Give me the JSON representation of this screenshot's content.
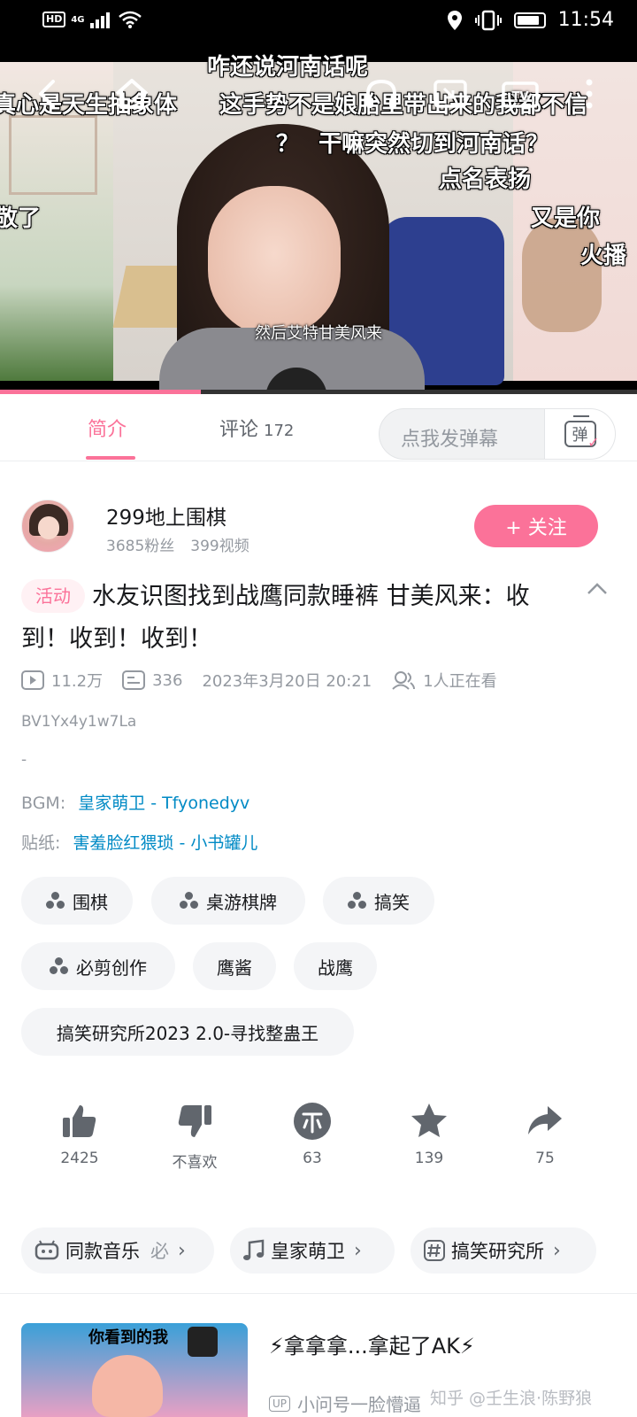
{
  "status_bar": {
    "left_badge": "HD",
    "signal": "4G",
    "time": "11:54"
  },
  "video": {
    "danmaku": [
      "咋还说河南话呢",
      "真心是天生抽象体",
      "这手势不是娘胎里带出来的我都不信",
      "？",
      "干嘛突然切到河南话？",
      "点名表扬",
      "又是你",
      "敬了",
      "火播"
    ],
    "subtitle": "然后艾特甘美风来",
    "progress_fraction": 0.315
  },
  "tabs": {
    "intro": "简介",
    "comments": "评论",
    "comments_count": "172",
    "danmaku_placeholder": "点我发弹幕",
    "danmaku_button": "弹"
  },
  "uploader": {
    "name": "299地上围棋",
    "fans": "3685粉丝",
    "videos": "399视频",
    "follow_label": "+ 关注"
  },
  "video_info": {
    "activity_tag": "活动",
    "title": "水友识图找到战鹰同款睡裤 甘美风来：收到！收到！收到！",
    "views": "11.2万",
    "danmaku_count": "336",
    "date": "2023年3月20日 20:21",
    "watching": "1人正在看",
    "bvid": "BV1Yx4y1w7La",
    "dash": "-",
    "bgm_label": "BGM:",
    "bgm_value": "皇家萌卫 - Tfyonedyv",
    "sticker_label": "贴纸:",
    "sticker_value": "害羞脸红猥琐 - 小书罐儿"
  },
  "tags": [
    "围棋",
    "桌游棋牌",
    "搞笑",
    "必剪创作",
    "鹰酱",
    "战鹰",
    "搞笑研究所2023 2.0-寻找整蛊王"
  ],
  "actions": {
    "like": "2425",
    "dislike": "不喜欢",
    "coin": "63",
    "favorite": "139",
    "share": "75"
  },
  "related": {
    "music": "同款音乐",
    "music_suffix": "必",
    "song": "皇家萌卫",
    "topic": "搞笑研究所"
  },
  "recommendation": {
    "thumb_title": "你看到的我",
    "title": "⚡拿拿拿...拿起了AK⚡",
    "up_badge": "UP",
    "up_name": "小问号一脸懵逼",
    "watermark": "知乎 @壬生浪·陈野狼"
  },
  "colors": {
    "accent": "#fb7299",
    "link": "#008ac5",
    "muted": "#9499a0"
  }
}
